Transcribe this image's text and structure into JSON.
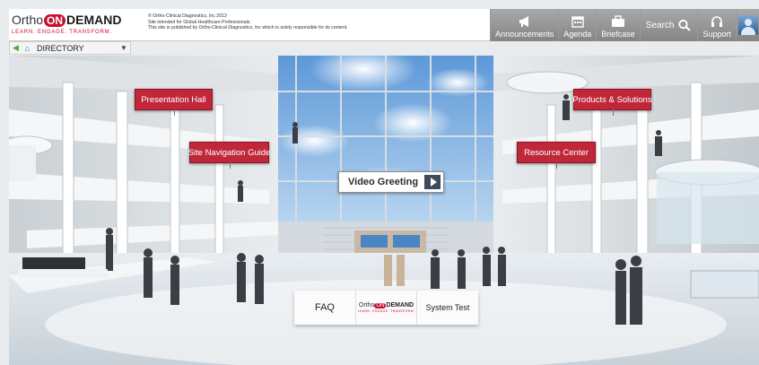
{
  "header": {
    "logo": {
      "ortho": "Ortho",
      "on": "ON",
      "demand": "DEMAND",
      "tagline": "LEARN. ENGAGE. TRANSFORM."
    },
    "legal": [
      "© Ortho-Clinical Diagnostics, Inc 2013",
      "Site intended for Global Healthcare Professionals.",
      "This site is published by Ortho-Clinical Diagnostics, Inc which is solely responsible for its content."
    ],
    "nav": {
      "announcements": "Announcements",
      "agenda": "Agenda",
      "briefcase": "Briefcase",
      "search": "Search",
      "support": "Support"
    }
  },
  "directory": {
    "label": "DIRECTORY"
  },
  "hotspots": {
    "presentation_hall": "Presentation Hall",
    "site_navigation_guide": "Site Navigation Guide",
    "products_solutions": "Products & Solutions",
    "resource_center": "Resource Center",
    "video_greeting": "Video Greeting"
  },
  "kiosk": {
    "faq": "FAQ",
    "logo_ortho": "Ortho",
    "logo_on": "ON",
    "logo_demand": "DEMAND",
    "logo_tagline": "LEARN. ENGAGE. TRANSFORM.",
    "system_test": "System Test"
  },
  "colors": {
    "brand_red": "#c8102e",
    "hotspot_red": "#c0283a",
    "nav_gray": "#989898",
    "sky": "#7fb2e4"
  }
}
